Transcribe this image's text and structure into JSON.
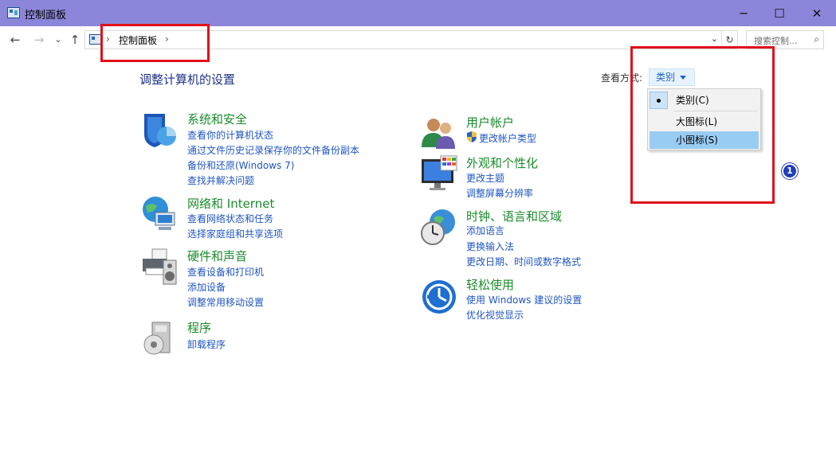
{
  "window": {
    "title": "控制面板",
    "minimize_glyph": "─",
    "maximize_glyph": "☐",
    "close_glyph": "✕"
  },
  "navbar": {
    "back_glyph": "←",
    "forward_glyph": "→",
    "recent_glyph": "⌄",
    "up_glyph": "↑",
    "crumb_sep1": "›",
    "breadcrumb": "控制面板",
    "crumb_sep2": "›",
    "dropdown_glyph": "⌄",
    "refresh_glyph": "↻",
    "search_placeholder": "搜索控制...",
    "search_glyph": "⌕"
  },
  "content": {
    "page_title": "调整计算机的设置",
    "view_by_label": "查看方式:",
    "view_by_value": "类别"
  },
  "view_menu": {
    "items": [
      {
        "label": "类别(C)",
        "checked": true,
        "highlighted": false
      },
      {
        "label": "大图标(L)",
        "checked": false,
        "highlighted": false
      },
      {
        "label": "小图标(S)",
        "checked": false,
        "highlighted": true
      }
    ]
  },
  "annotation": {
    "badge": "1"
  },
  "categories_left": [
    {
      "name": "系统和安全",
      "icon": "shield-icon",
      "links": [
        "查看你的计算机状态",
        "通过文件历史记录保存你的文件备份副本",
        "备份和还原(Windows 7)",
        "查找并解决问题"
      ]
    },
    {
      "name": "网络和 Internet",
      "icon": "network-globe-icon",
      "links": [
        "查看网络状态和任务",
        "选择家庭组和共享选项"
      ]
    },
    {
      "name": "硬件和声音",
      "icon": "printer-speaker-icon",
      "links": [
        "查看设备和打印机",
        "添加设备",
        "调整常用移动设置"
      ]
    },
    {
      "name": "程序",
      "icon": "programs-disc-icon",
      "links": [
        "卸载程序"
      ]
    }
  ],
  "categories_right": [
    {
      "name": "用户帐户",
      "icon": "users-icon",
      "links": [
        "更改帐户类型"
      ]
    },
    {
      "name": "外观和个性化",
      "icon": "monitor-palette-icon",
      "links": [
        "更改主题",
        "调整屏幕分辨率"
      ]
    },
    {
      "name": "时钟、语言和区域",
      "icon": "clock-globe-icon",
      "links": [
        "添加语言",
        "更换输入法",
        "更改日期、时间或数字格式"
      ]
    },
    {
      "name": "轻松使用",
      "icon": "ease-of-access-icon",
      "links": [
        "使用 Windows 建议的设置",
        "优化视觉显示"
      ]
    }
  ],
  "colors": {
    "titlebar": "#8b86d9",
    "heading_green": "#1a8b2c",
    "link_blue": "#1f56c2",
    "title_blue": "#1e3287",
    "annotation_red": "#e0101a"
  }
}
